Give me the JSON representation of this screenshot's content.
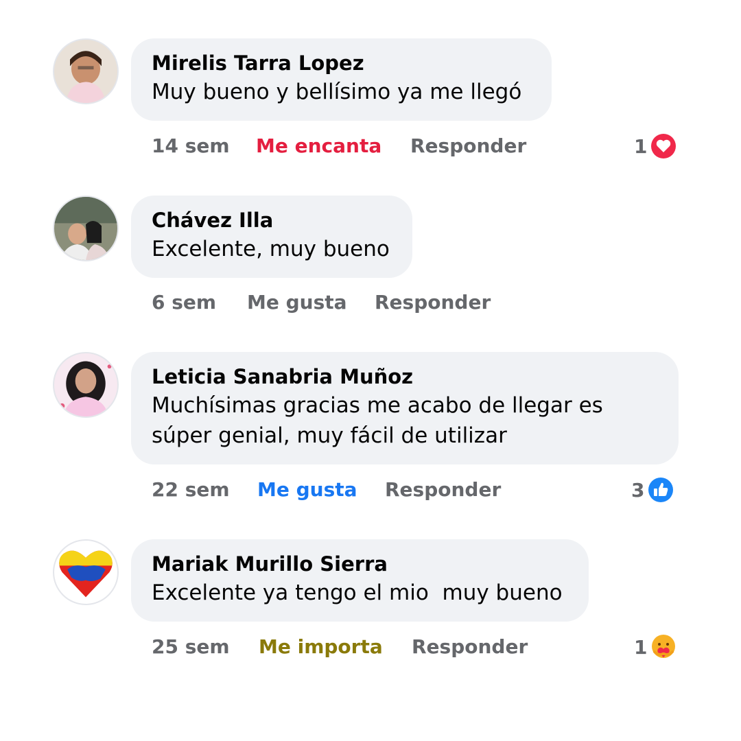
{
  "comments": [
    {
      "author": "Mirelis Tarra Lopez",
      "text": "Muy bueno y bellísimo ya me llegó",
      "time": "14 sem",
      "reaction_label": "Me encanta",
      "reaction_color": "#e41e3f",
      "reply_label": "Responder",
      "reaction_count": "1",
      "reaction_icon": "love-icon"
    },
    {
      "author": "Chávez Illa",
      "text": "Excelente, muy bueno",
      "time": "6 sem",
      "reaction_label": "Me gusta",
      "reaction_color": "#65676b",
      "reply_label": "Responder"
    },
    {
      "author": "Leticia Sanabria Muñoz",
      "text": "Muchísimas gracias me acabo de llegar es súper genial, muy fácil de utilizar",
      "time": "22 sem",
      "reaction_label": "Me gusta",
      "reaction_color": "#1877f2",
      "reply_label": "Responder",
      "reaction_count": "3",
      "reaction_icon": "like-icon"
    },
    {
      "author": "Mariak Murillo Sierra",
      "text": "Excelente ya tengo el mio  muy bueno",
      "time": "25 sem",
      "reaction_label": "Me importa",
      "reaction_color": "#8a7a0a",
      "reply_label": "Responder",
      "reaction_count": "1",
      "reaction_icon": "care-icon"
    }
  ]
}
